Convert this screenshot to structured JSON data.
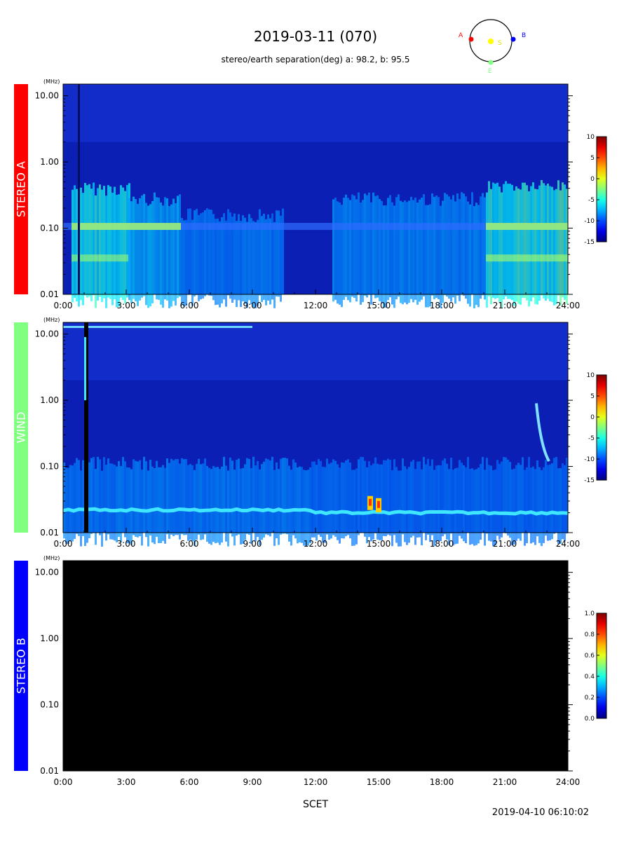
{
  "header": {
    "title": "2019-03-11 (070)",
    "subtitle": "stereo/earth separation(deg) a:  98.2, b:  95.5"
  },
  "orbit_labels": {
    "a": "A",
    "b": "B",
    "s": "S",
    "e": "E"
  },
  "colors": {
    "stereo_a": "#ff0000",
    "wind": "#80ff80",
    "stereo_b": "#0000ff",
    "sun": "#ffff00",
    "background_spectrum": "#0a1fb8"
  },
  "chart_data": [
    {
      "type": "heatmap",
      "panel": "STEREO A",
      "ylabel": "(MHz)",
      "x_ticks": [
        "0:00",
        "3:00",
        "6:00",
        "9:00",
        "12:00",
        "15:00",
        "18:00",
        "21:00",
        "24:00"
      ],
      "xlim": [
        0,
        24
      ],
      "y_ticks": [
        "10.00",
        "1.00",
        "0.10",
        "0.01"
      ],
      "ylim": [
        0.01,
        15
      ],
      "y_scale": "log",
      "colorbar": {
        "ticks": [
          "10",
          "5",
          "0",
          "-5",
          "-10",
          "-15"
        ],
        "range": [
          -15,
          10
        ]
      },
      "bursts": [
        {
          "t0": 0.4,
          "t1": 3.1,
          "fmax": 0.5,
          "level": 0.8
        },
        {
          "t0": 3.1,
          "t1": 5.6,
          "fmax": 0.35,
          "level": 0.45
        },
        {
          "t0": 5.6,
          "t1": 10.5,
          "fmax": 0.2,
          "level": 0.25
        },
        {
          "t0": 12.8,
          "t1": 20.1,
          "fmax": 0.35,
          "level": 0.3
        },
        {
          "t0": 20.1,
          "t1": 24.0,
          "fmax": 0.55,
          "level": 0.9
        }
      ]
    },
    {
      "type": "heatmap",
      "panel": "WIND",
      "ylabel": "(MHz)",
      "x_ticks": [
        "0:00",
        "3:00",
        "6:00",
        "9:00",
        "12:00",
        "15:00",
        "18:00",
        "21:00",
        "24:00"
      ],
      "xlim": [
        0,
        24
      ],
      "y_ticks": [
        "10.00",
        "1.00",
        "0.10",
        "0.01"
      ],
      "ylim": [
        0.01,
        15
      ],
      "y_scale": "log",
      "colorbar": {
        "ticks": [
          "10",
          "5",
          "0",
          "-5",
          "-10",
          "-15"
        ],
        "range": [
          -15,
          10
        ]
      },
      "bursts": [
        {
          "t0": 0.0,
          "t1": 11.8,
          "fmax": 0.14,
          "level": 0.25
        },
        {
          "t0": 11.8,
          "t1": 24.0,
          "fmax": 0.14,
          "level": 0.18
        }
      ],
      "events": [
        {
          "t": 14.6,
          "f": 0.028,
          "label": "burst"
        },
        {
          "t": 15.0,
          "f": 0.026,
          "label": "burst"
        },
        {
          "t": 22.8,
          "f": 0.5,
          "label": "type III"
        }
      ]
    },
    {
      "type": "heatmap",
      "panel": "STEREO B",
      "ylabel": "(MHz)",
      "x_ticks": [
        "0:00",
        "3:00",
        "6:00",
        "9:00",
        "12:00",
        "15:00",
        "18:00",
        "21:00",
        "24:00"
      ],
      "xlim": [
        0,
        24
      ],
      "y_ticks": [
        "10.00",
        "1.00",
        "0.10",
        "0.01"
      ],
      "ylim": [
        0.01,
        15
      ],
      "y_scale": "log",
      "colorbar": {
        "ticks": [
          "1.0",
          "0.8",
          "0.6",
          "0.4",
          "0.2",
          "0.0"
        ],
        "range": [
          0,
          1
        ]
      },
      "no_data": true
    }
  ],
  "footer": {
    "xlabel": "SCET",
    "timestamp": "2019-04-10 06:10:02"
  }
}
